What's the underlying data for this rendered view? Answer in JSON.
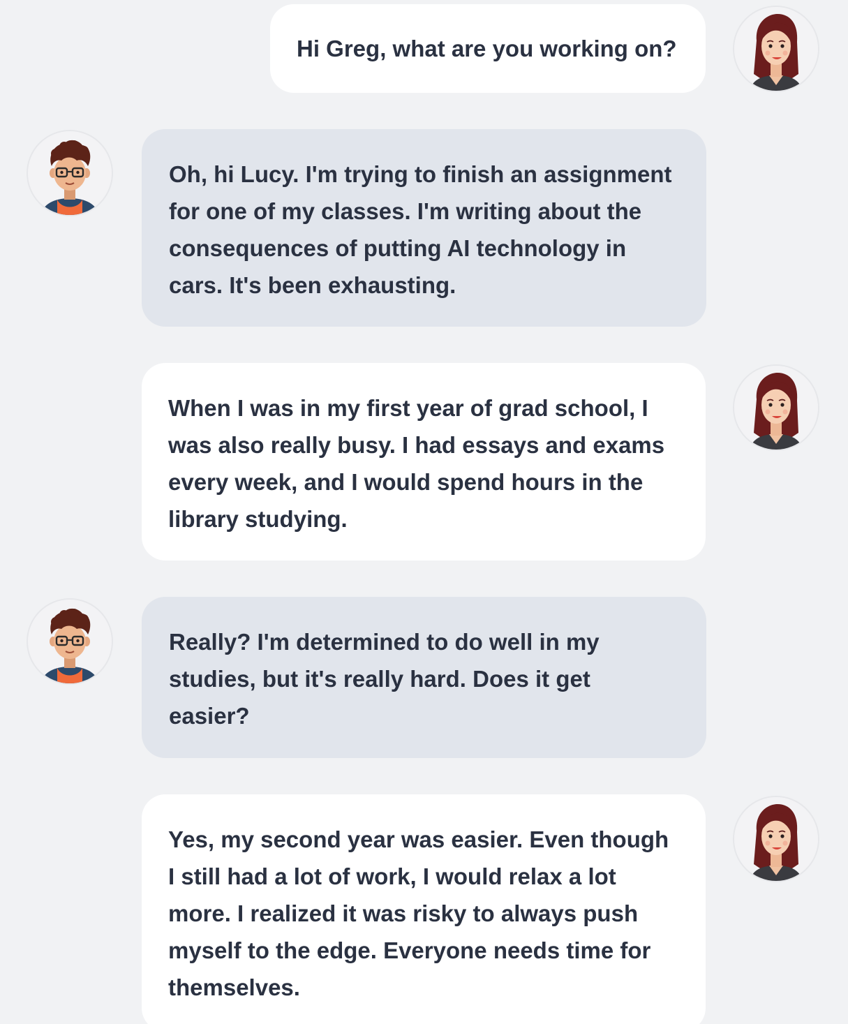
{
  "participants": {
    "lucy": {
      "avatar_icon": "woman-avatar-icon"
    },
    "greg": {
      "avatar_icon": "man-with-glasses-avatar-icon"
    }
  },
  "colors": {
    "background": "#f1f2f4",
    "lucy_bubble": "#ffffff",
    "greg_bubble": "#e1e5ec",
    "text": "#2a3141"
  },
  "messages": [
    {
      "speaker": "lucy",
      "text": "Hi Greg, what are you working on?"
    },
    {
      "speaker": "greg",
      "text": "Oh, hi Lucy. I'm trying to finish an assignment for one of my classes. I'm writing about the consequences of putting AI technology in cars. It's been exhausting."
    },
    {
      "speaker": "lucy",
      "text": "When I was in my first year of grad school, I was also really busy. I had essays and exams every week, and I would spend hours in the library studying."
    },
    {
      "speaker": "greg",
      "text": "Really? I'm determined to do well in my studies, but it's really hard. Does it get easier?"
    },
    {
      "speaker": "lucy",
      "text": "Yes, my second year was easier. Even though I still had a lot of work, I would relax a lot more. I realized it was risky to always push myself to the edge. Everyone needs time for themselves."
    }
  ]
}
